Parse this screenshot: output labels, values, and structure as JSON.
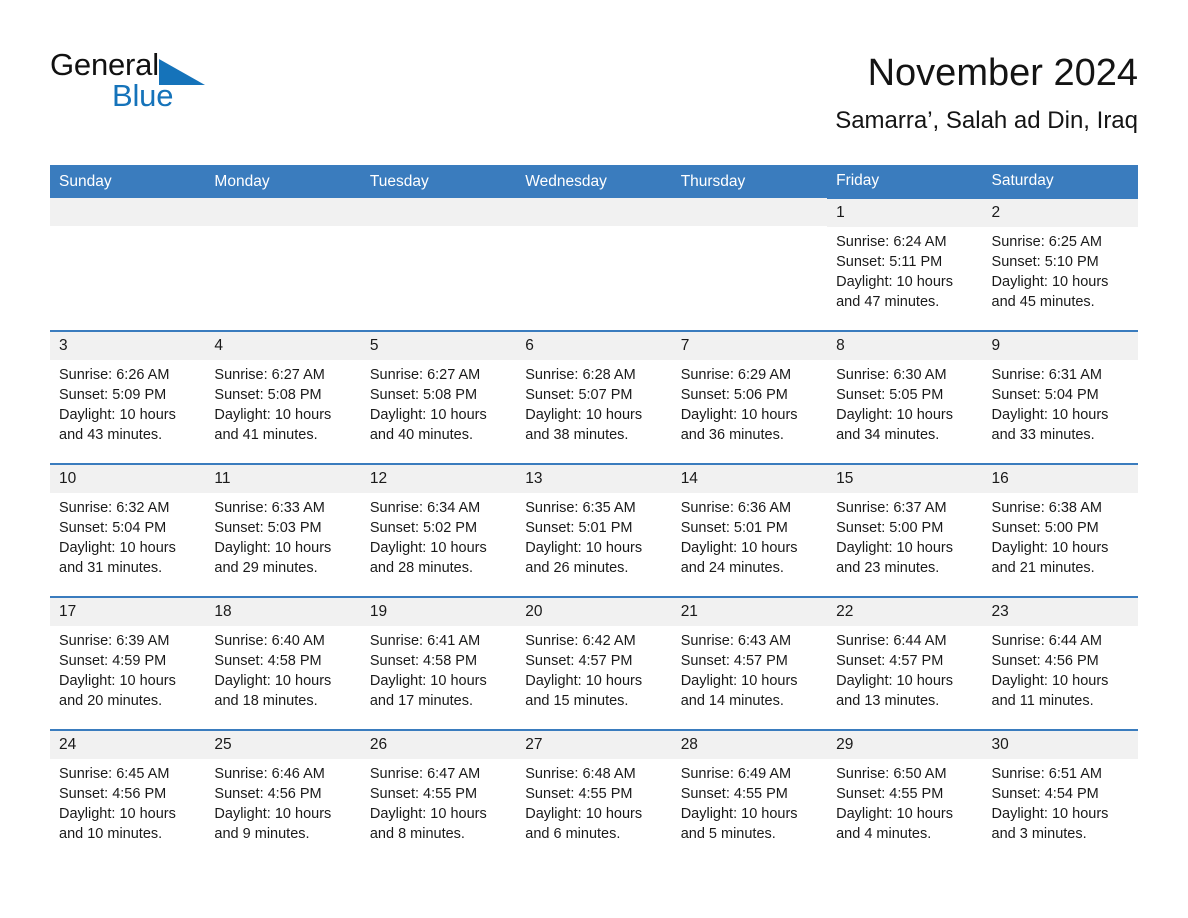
{
  "brand": {
    "word1": "General",
    "word2": "Blue",
    "flag_color": "#1573ba"
  },
  "header": {
    "title": "November 2024",
    "subtitle": "Samarra’, Salah ad Din, Iraq",
    "header_bg": "#3a7cbe",
    "daynum_bg": "#f1f1f1"
  },
  "weekdays": [
    "Sunday",
    "Monday",
    "Tuesday",
    "Wednesday",
    "Thursday",
    "Friday",
    "Saturday"
  ],
  "weeks": [
    [
      {
        "empty": true
      },
      {
        "empty": true
      },
      {
        "empty": true
      },
      {
        "empty": true
      },
      {
        "empty": true
      },
      {
        "day": "1",
        "sunrise": "Sunrise: 6:24 AM",
        "sunset": "Sunset: 5:11 PM",
        "daylight": "Daylight: 10 hours and 47 minutes."
      },
      {
        "day": "2",
        "sunrise": "Sunrise: 6:25 AM",
        "sunset": "Sunset: 5:10 PM",
        "daylight": "Daylight: 10 hours and 45 minutes."
      }
    ],
    [
      {
        "day": "3",
        "sunrise": "Sunrise: 6:26 AM",
        "sunset": "Sunset: 5:09 PM",
        "daylight": "Daylight: 10 hours and 43 minutes."
      },
      {
        "day": "4",
        "sunrise": "Sunrise: 6:27 AM",
        "sunset": "Sunset: 5:08 PM",
        "daylight": "Daylight: 10 hours and 41 minutes."
      },
      {
        "day": "5",
        "sunrise": "Sunrise: 6:27 AM",
        "sunset": "Sunset: 5:08 PM",
        "daylight": "Daylight: 10 hours and 40 minutes."
      },
      {
        "day": "6",
        "sunrise": "Sunrise: 6:28 AM",
        "sunset": "Sunset: 5:07 PM",
        "daylight": "Daylight: 10 hours and 38 minutes."
      },
      {
        "day": "7",
        "sunrise": "Sunrise: 6:29 AM",
        "sunset": "Sunset: 5:06 PM",
        "daylight": "Daylight: 10 hours and 36 minutes."
      },
      {
        "day": "8",
        "sunrise": "Sunrise: 6:30 AM",
        "sunset": "Sunset: 5:05 PM",
        "daylight": "Daylight: 10 hours and 34 minutes."
      },
      {
        "day": "9",
        "sunrise": "Sunrise: 6:31 AM",
        "sunset": "Sunset: 5:04 PM",
        "daylight": "Daylight: 10 hours and 33 minutes."
      }
    ],
    [
      {
        "day": "10",
        "sunrise": "Sunrise: 6:32 AM",
        "sunset": "Sunset: 5:04 PM",
        "daylight": "Daylight: 10 hours and 31 minutes."
      },
      {
        "day": "11",
        "sunrise": "Sunrise: 6:33 AM",
        "sunset": "Sunset: 5:03 PM",
        "daylight": "Daylight: 10 hours and 29 minutes."
      },
      {
        "day": "12",
        "sunrise": "Sunrise: 6:34 AM",
        "sunset": "Sunset: 5:02 PM",
        "daylight": "Daylight: 10 hours and 28 minutes."
      },
      {
        "day": "13",
        "sunrise": "Sunrise: 6:35 AM",
        "sunset": "Sunset: 5:01 PM",
        "daylight": "Daylight: 10 hours and 26 minutes."
      },
      {
        "day": "14",
        "sunrise": "Sunrise: 6:36 AM",
        "sunset": "Sunset: 5:01 PM",
        "daylight": "Daylight: 10 hours and 24 minutes."
      },
      {
        "day": "15",
        "sunrise": "Sunrise: 6:37 AM",
        "sunset": "Sunset: 5:00 PM",
        "daylight": "Daylight: 10 hours and 23 minutes."
      },
      {
        "day": "16",
        "sunrise": "Sunrise: 6:38 AM",
        "sunset": "Sunset: 5:00 PM",
        "daylight": "Daylight: 10 hours and 21 minutes."
      }
    ],
    [
      {
        "day": "17",
        "sunrise": "Sunrise: 6:39 AM",
        "sunset": "Sunset: 4:59 PM",
        "daylight": "Daylight: 10 hours and 20 minutes."
      },
      {
        "day": "18",
        "sunrise": "Sunrise: 6:40 AM",
        "sunset": "Sunset: 4:58 PM",
        "daylight": "Daylight: 10 hours and 18 minutes."
      },
      {
        "day": "19",
        "sunrise": "Sunrise: 6:41 AM",
        "sunset": "Sunset: 4:58 PM",
        "daylight": "Daylight: 10 hours and 17 minutes."
      },
      {
        "day": "20",
        "sunrise": "Sunrise: 6:42 AM",
        "sunset": "Sunset: 4:57 PM",
        "daylight": "Daylight: 10 hours and 15 minutes."
      },
      {
        "day": "21",
        "sunrise": "Sunrise: 6:43 AM",
        "sunset": "Sunset: 4:57 PM",
        "daylight": "Daylight: 10 hours and 14 minutes."
      },
      {
        "day": "22",
        "sunrise": "Sunrise: 6:44 AM",
        "sunset": "Sunset: 4:57 PM",
        "daylight": "Daylight: 10 hours and 13 minutes."
      },
      {
        "day": "23",
        "sunrise": "Sunrise: 6:44 AM",
        "sunset": "Sunset: 4:56 PM",
        "daylight": "Daylight: 10 hours and 11 minutes."
      }
    ],
    [
      {
        "day": "24",
        "sunrise": "Sunrise: 6:45 AM",
        "sunset": "Sunset: 4:56 PM",
        "daylight": "Daylight: 10 hours and 10 minutes."
      },
      {
        "day": "25",
        "sunrise": "Sunrise: 6:46 AM",
        "sunset": "Sunset: 4:56 PM",
        "daylight": "Daylight: 10 hours and 9 minutes."
      },
      {
        "day": "26",
        "sunrise": "Sunrise: 6:47 AM",
        "sunset": "Sunset: 4:55 PM",
        "daylight": "Daylight: 10 hours and 8 minutes."
      },
      {
        "day": "27",
        "sunrise": "Sunrise: 6:48 AM",
        "sunset": "Sunset: 4:55 PM",
        "daylight": "Daylight: 10 hours and 6 minutes."
      },
      {
        "day": "28",
        "sunrise": "Sunrise: 6:49 AM",
        "sunset": "Sunset: 4:55 PM",
        "daylight": "Daylight: 10 hours and 5 minutes."
      },
      {
        "day": "29",
        "sunrise": "Sunrise: 6:50 AM",
        "sunset": "Sunset: 4:55 PM",
        "daylight": "Daylight: 10 hours and 4 minutes."
      },
      {
        "day": "30",
        "sunrise": "Sunrise: 6:51 AM",
        "sunset": "Sunset: 4:54 PM",
        "daylight": "Daylight: 10 hours and 3 minutes."
      }
    ]
  ]
}
